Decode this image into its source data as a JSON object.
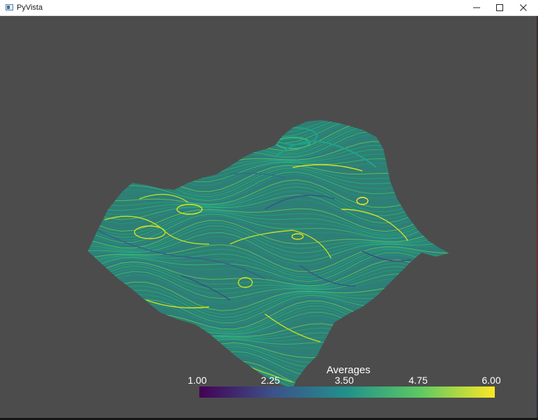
{
  "window": {
    "title": "PyVista",
    "app_icon": "pyvista-window-icon",
    "controls": {
      "minimize_icon": "minimize-icon",
      "maximize_icon": "maximize-icon",
      "close_icon": "close-icon"
    }
  },
  "viewport": {
    "background_color": "#4c4c4c",
    "mesh": {
      "description_icon": "contour-surface",
      "colormap": "viridis"
    }
  },
  "scalar_bar": {
    "title": "Averages",
    "tick_labels": [
      "1.00",
      "2.25",
      "3.50",
      "4.75",
      "6.00"
    ],
    "range": [
      1.0,
      6.0
    ],
    "colormap_stops": [
      "#440154",
      "#3b528b",
      "#21918c",
      "#5ec962",
      "#fde725"
    ]
  }
}
